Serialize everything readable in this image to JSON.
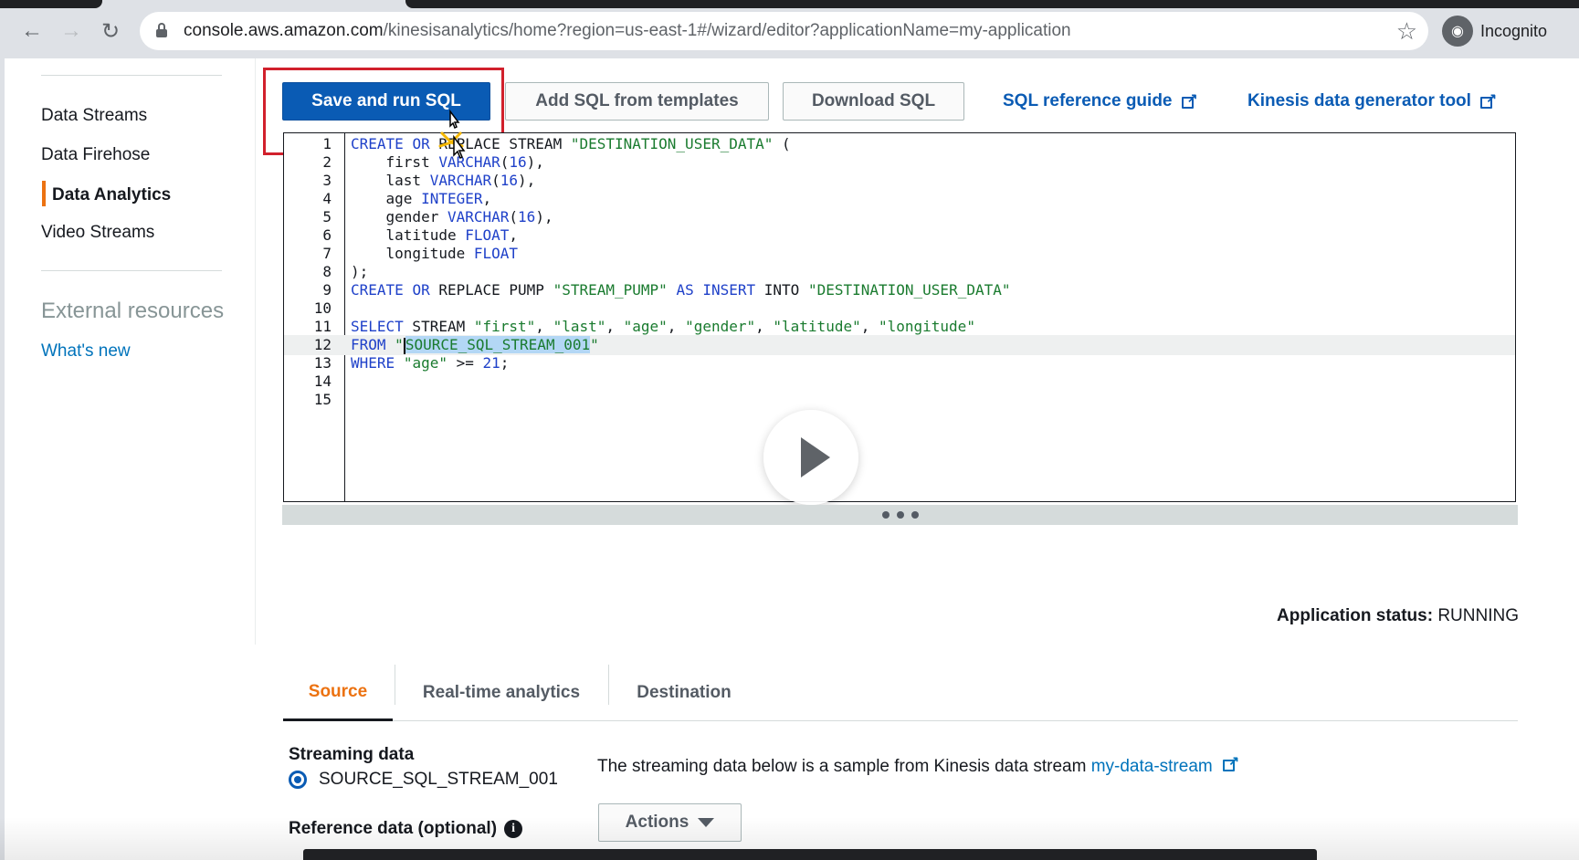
{
  "browser": {
    "url_host": "console.aws.amazon.com",
    "url_path": "/kinesisanalytics/home?region=us-east-1#/wizard/editor?applicationName=my-application",
    "profile_label": "Incognito"
  },
  "sidebar": {
    "items": [
      {
        "label": "Data Streams"
      },
      {
        "label": "Data Firehose"
      },
      {
        "label": "Data Analytics",
        "active": true
      },
      {
        "label": "Video Streams"
      }
    ],
    "external_heading": "External resources",
    "whats_new": "What's new"
  },
  "toolbar": {
    "save_run_label": "Save and run SQL",
    "add_templates_label": "Add SQL from templates",
    "download_label": "Download SQL",
    "sql_reference_label": "SQL reference guide",
    "kinesis_generator_label": "Kinesis data generator tool"
  },
  "editor": {
    "line_numbers": [
      "1",
      "2",
      "3",
      "4",
      "5",
      "6",
      "7",
      "8",
      "9",
      "10",
      "11",
      "12",
      "13",
      "14",
      "15"
    ],
    "current_line": 12,
    "lines": [
      "CREATE OR REPLACE STREAM \"DESTINATION_USER_DATA\" (",
      "    first VARCHAR(16),",
      "    last VARCHAR(16),",
      "    age INTEGER,",
      "    gender VARCHAR(16),",
      "    latitude FLOAT,",
      "    longitude FLOAT",
      ");",
      "CREATE OR REPLACE PUMP \"STREAM_PUMP\" AS INSERT INTO \"DESTINATION_USER_DATA\"",
      "",
      "SELECT STREAM \"first\", \"last\", \"age\", \"gender\", \"latitude\", \"longitude\"",
      "FROM \"SOURCE_SQL_STREAM_001\"",
      "WHERE \"age\" >= 21;",
      "",
      ""
    ]
  },
  "status": {
    "label": "Application status:",
    "value": "RUNNING"
  },
  "tabs": [
    {
      "label": "Source",
      "active": true
    },
    {
      "label": "Real-time analytics"
    },
    {
      "label": "Destination"
    }
  ],
  "source": {
    "streaming_heading": "Streaming data",
    "stream_name": "SOURCE_SQL_STREAM_001",
    "sample_text": "The streaming data below is a sample from Kinesis data stream",
    "stream_link": "my-data-stream",
    "reference_heading": "Reference data (optional)",
    "actions_label": "Actions"
  },
  "colors": {
    "primary_button": "#0a5bb4",
    "accent_orange": "#ec7211",
    "highlight_red": "#d1202c",
    "link_blue": "#0073bb"
  }
}
